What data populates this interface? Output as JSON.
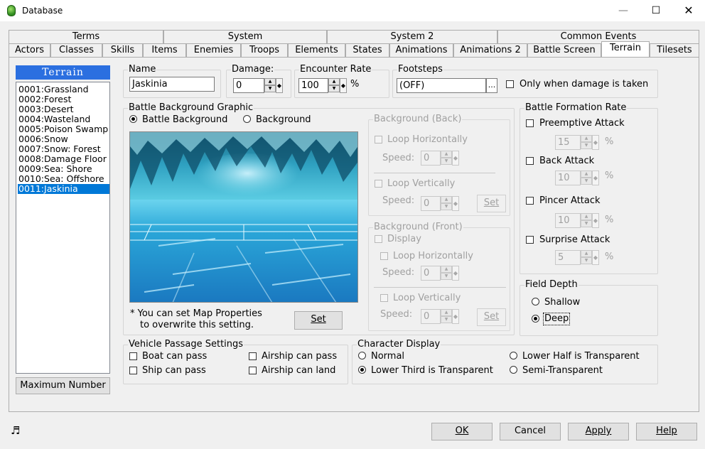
{
  "window": {
    "title": "Database"
  },
  "tabs_row1": [
    "Terms",
    "System",
    "System 2",
    "Common Events"
  ],
  "tabs_row2": [
    "Actors",
    "Classes",
    "Skills",
    "Items",
    "Enemies",
    "Troops",
    "Elements",
    "States",
    "Animations",
    "Animations 2",
    "Battle Screen",
    "Terrain",
    "Tilesets"
  ],
  "active_tab": "Terrain",
  "sidebar": {
    "header": "Terrain",
    "items": [
      "0001:Grassland",
      "0002:Forest",
      "0003:Desert",
      "0004:Wasteland",
      "0005:Poison Swamp",
      "0006:Snow",
      "0007:Snow: Forest",
      "0008:Damage Floor",
      "0009:Sea: Shore",
      "0010:Sea: Offshore",
      "0011:Jaskinia"
    ],
    "selected_index": 10,
    "max_button": "Maximum Number"
  },
  "name": {
    "label": "Name",
    "value": "Jaskinia"
  },
  "damage": {
    "label": "Damage:",
    "value": "0"
  },
  "encounter": {
    "label": "Encounter Rate",
    "value": "100",
    "unit": "%"
  },
  "footsteps": {
    "label": "Footsteps",
    "value": "(OFF)",
    "browse": "..."
  },
  "only_damage": {
    "label": "Only when damage is taken",
    "checked": false
  },
  "battle_bg": {
    "label": "Battle Background Graphic",
    "opt1": "Battle Background",
    "opt2": "Background",
    "selected": "Battle Background",
    "note1": "* You can set Map Properties",
    "note2": "to overwrite this setting.",
    "set_button": "Set"
  },
  "bg_back": {
    "label": "Background (Back)",
    "loop_h": "Loop Horizontally",
    "speed1_label": "Speed:",
    "speed1": "0",
    "loop_v": "Loop Vertically",
    "speed2_label": "Speed:",
    "speed2": "0",
    "set": "Set"
  },
  "bg_front": {
    "label": "Background (Front)",
    "display": "Display",
    "loop_h": "Loop Horizontally",
    "speed1_label": "Speed:",
    "speed1": "0",
    "loop_v": "Loop Vertically",
    "speed2_label": "Speed:",
    "speed2": "0",
    "set": "Set"
  },
  "formation": {
    "label": "Battle Formation Rate",
    "preemptive": {
      "label": "Preemptive Attack",
      "value": "15"
    },
    "back": {
      "label": "Back Attack",
      "value": "10"
    },
    "pincer": {
      "label": "Pincer Attack",
      "value": "10"
    },
    "surprise": {
      "label": "Surprise Attack",
      "value": "5"
    },
    "unit": "%"
  },
  "field_depth": {
    "label": "Field Depth",
    "shallow": "Shallow",
    "deep": "Deep",
    "selected": "Deep"
  },
  "vehicle": {
    "label": "Vehicle Passage Settings",
    "boat": "Boat can pass",
    "ship": "Ship can pass",
    "airship_pass": "Airship can pass",
    "airship_land": "Airship can land"
  },
  "char_display": {
    "label": "Character Display",
    "normal": "Normal",
    "lower_third": "Lower Third is Transparent",
    "lower_half": "Lower Half is Transparent",
    "semi": "Semi-Transparent",
    "selected": "Lower Third is Transparent"
  },
  "footer": {
    "ok": "OK",
    "cancel": "Cancel",
    "apply": "Apply",
    "help": "Help"
  },
  "icons": [
    "app-icon",
    "minimize-icon",
    "maximize-icon",
    "close-icon",
    "music-note-icon",
    "spin-up-icon",
    "spin-down-icon"
  ]
}
